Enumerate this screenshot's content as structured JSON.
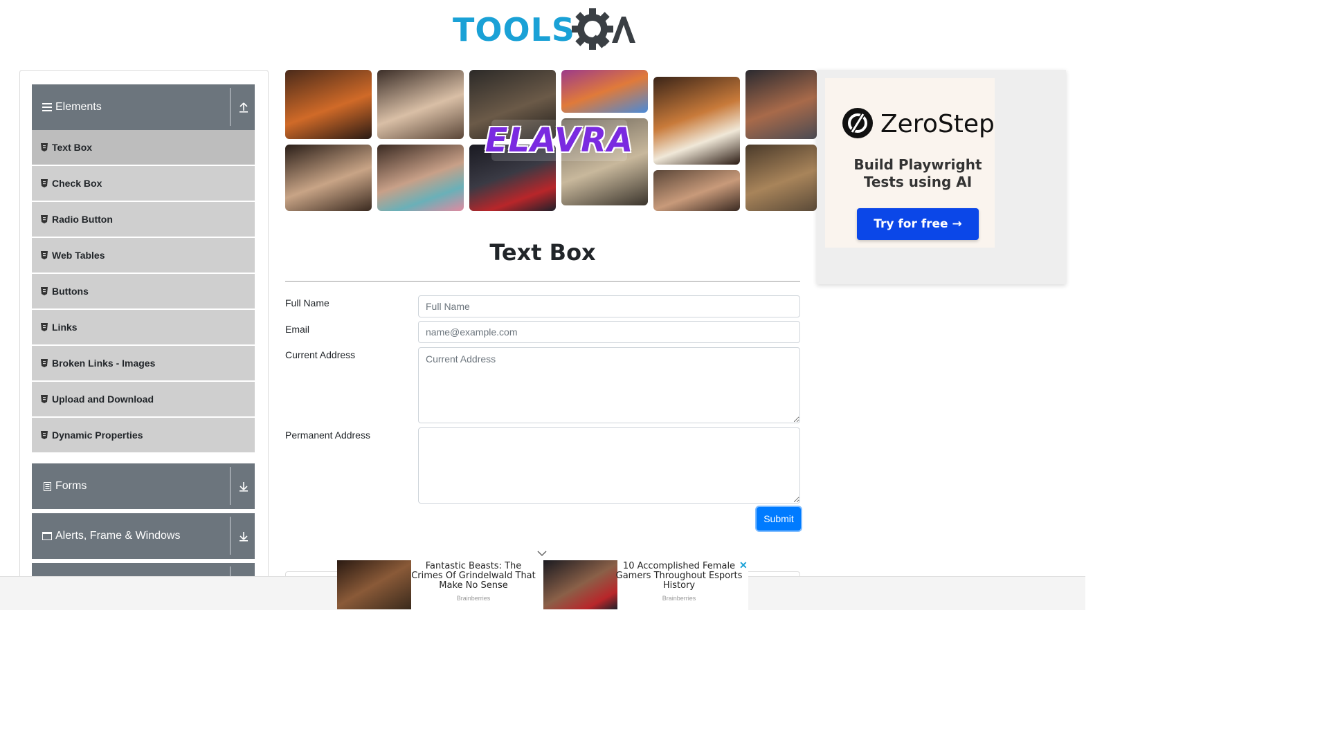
{
  "header": {
    "logo_text": "TOOLS",
    "logo_suffix": "QA"
  },
  "sidebar": {
    "groups": [
      {
        "label": "Elements",
        "icon": "hamburger-icon",
        "expanded": true
      },
      {
        "label": "Forms",
        "icon": "document-icon",
        "expanded": false
      },
      {
        "label": "Alerts, Frame & Windows",
        "icon": "window-icon",
        "expanded": false
      }
    ],
    "items": [
      {
        "label": "Text Box",
        "active": true
      },
      {
        "label": "Check Box"
      },
      {
        "label": "Radio Button"
      },
      {
        "label": "Web Tables"
      },
      {
        "label": "Buttons"
      },
      {
        "label": "Links"
      },
      {
        "label": "Broken Links - Images"
      },
      {
        "label": "Upload and Download"
      },
      {
        "label": "Dynamic Properties"
      }
    ]
  },
  "banner": {
    "text": "ELAVRA"
  },
  "ad_right": {
    "brand": "ZeroStep",
    "tagline": "Build Playwright Tests using AI",
    "cta": "Try for free →"
  },
  "main": {
    "title": "Text Box",
    "fields": {
      "full_name": {
        "label": "Full Name",
        "placeholder": "Full Name",
        "value": ""
      },
      "email": {
        "label": "Email",
        "placeholder": "name@example.com",
        "value": ""
      },
      "current_address": {
        "label": "Current Address",
        "placeholder": "Current Address",
        "value": ""
      },
      "permanent_address": {
        "label": "Permanent Address",
        "placeholder": "",
        "value": ""
      }
    },
    "submit_label": "Submit"
  },
  "bottom_ad": {
    "items": [
      {
        "headline": "Fantastic Beasts: The Crimes Of Grindelwald That Make No Sense",
        "source": "Brainberries"
      },
      {
        "headline": "10 Accomplished Female Gamers Throughout Esports History",
        "source": "Brainberries"
      }
    ],
    "close_label": "✕"
  },
  "colors": {
    "accent": "#007bff",
    "sidebar_header": "#6c757d",
    "sidebar_item": "#cfcfcf",
    "logo_blue": "#1aa1d6",
    "ad_cta": "#0b47e8"
  }
}
